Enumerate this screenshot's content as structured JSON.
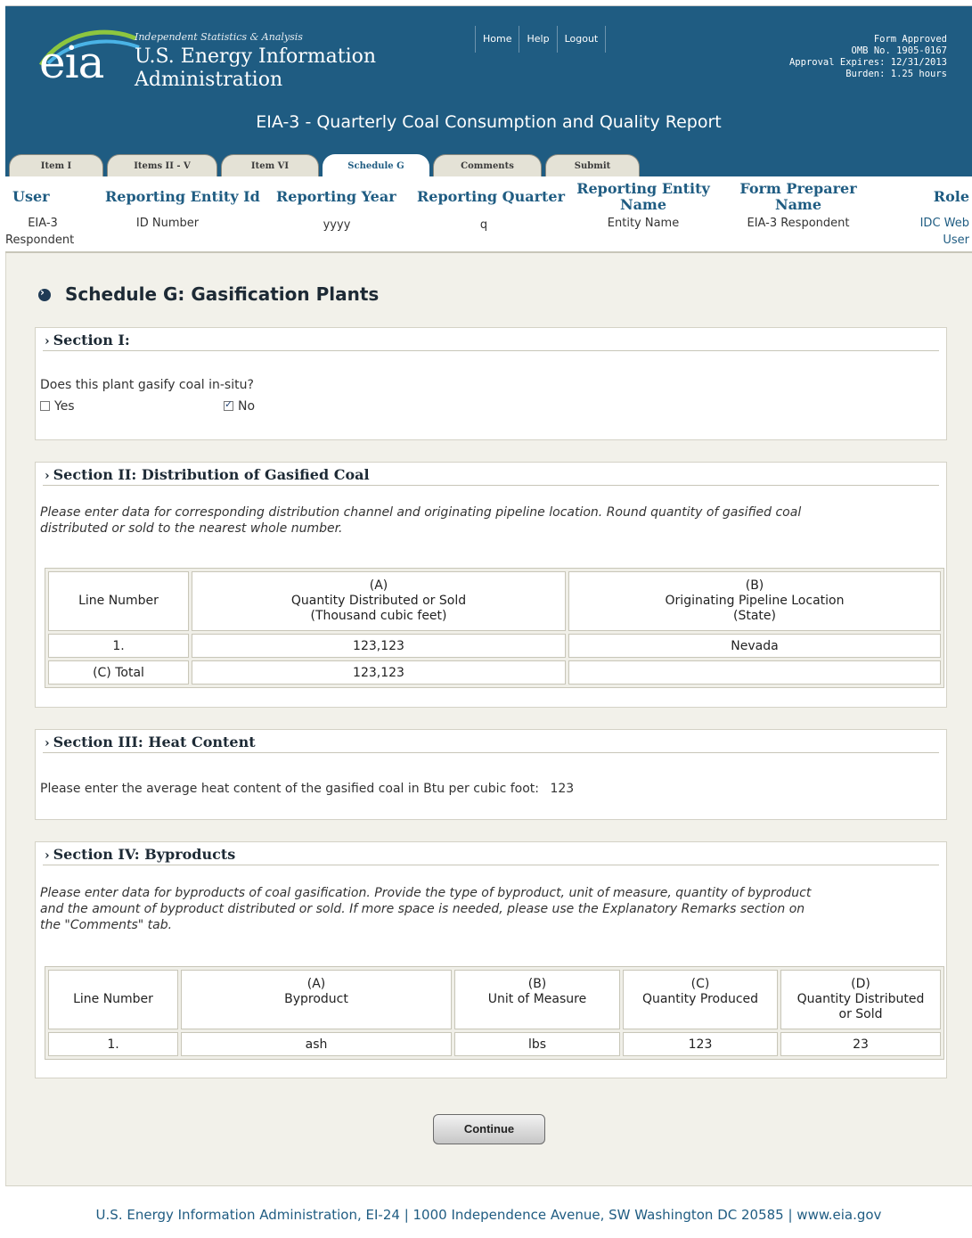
{
  "header": {
    "logo_text": "eia",
    "tagline": "Independent Statistics & Analysis",
    "org_line1": "U.S. Energy Information",
    "org_line2": "Administration",
    "nav": [
      "Home",
      "Help",
      "Logout"
    ],
    "approval": [
      "Form Approved",
      "OMB No. 1905-0167",
      "Approval Expires: 12/31/2013",
      "Burden: 1.25 hours"
    ],
    "form_title": "EIA-3 - Quarterly Coal Consumption and Quality Report",
    "colors": {
      "banner": "#1f5c82",
      "logo_swoosh_green": "#8dc63f",
      "logo_swoosh_blue": "#4ab3e6"
    }
  },
  "tabs": [
    {
      "label": "Item I",
      "active": false
    },
    {
      "label": "Items II - V",
      "active": false
    },
    {
      "label": "Item VI",
      "active": false
    },
    {
      "label": "Schedule G",
      "active": true
    },
    {
      "label": "Comments",
      "active": false
    },
    {
      "label": "Submit",
      "active": false
    }
  ],
  "info": {
    "headers": [
      "User",
      "Reporting Entity Id",
      "Reporting Year",
      "Reporting Quarter",
      "Reporting Entity Name",
      "Form Preparer Name",
      "Role"
    ],
    "user_1": "EIA-3",
    "user_2": "Respondent",
    "entity_id": "ID Number",
    "year": "yyyy",
    "quarter": "q",
    "entity_name": "Entity Name",
    "preparer": "EIA-3 Respondent",
    "role_1": "IDC Web",
    "role_2": "User"
  },
  "page": {
    "heading_icon": "circle-chevron-right-icon",
    "heading": "Schedule G: Gasification Plants"
  },
  "section1": {
    "title": "Section I:",
    "question": "Does this plant gasify coal in-situ?",
    "yes_label": "Yes",
    "no_label": "No",
    "yes_checked": false,
    "no_checked": true
  },
  "section2": {
    "title": "Section II: Distribution of Gasified Coal",
    "instr_1": "Please enter data for corresponding distribution channel and originating pipeline location. Round quantity of gasified coal",
    "instr_2": "distributed or sold to the nearest whole number.",
    "col_line": "Line Number",
    "col_a": [
      "(A)",
      "Quantity Distributed or Sold",
      "(Thousand cubic feet)"
    ],
    "col_b": [
      "(B)",
      "Originating Pipeline Location",
      "(State)"
    ],
    "rows": [
      {
        "line": "1.",
        "qty": "123,123",
        "state": "Nevada"
      }
    ],
    "total_label": "(C) Total",
    "total_value": "123,123"
  },
  "section3": {
    "title": "Section III: Heat Content",
    "text": "Please enter the average heat content of the gasified coal in Btu per cubic foot:",
    "value": "123"
  },
  "section4": {
    "title": "Section IV: Byproducts",
    "instr_1": "Please enter data for byproducts of coal gasification. Provide the type of byproduct, unit of measure, quantity of byproduct",
    "instr_2": "and the amount of byproduct distributed or sold. If more space is needed, please use the Explanatory Remarks section on",
    "instr_3": "the \"Comments\" tab.",
    "col_line": "Line Number",
    "col_a": [
      "(A)",
      "Byproduct"
    ],
    "col_b": [
      "(B)",
      "Unit of Measure"
    ],
    "col_c": [
      "(C)",
      "Quantity Produced"
    ],
    "col_d": [
      "(D)",
      "Quantity Distributed",
      "or Sold"
    ],
    "rows": [
      {
        "line": "1.",
        "byproduct": "ash",
        "unit": "lbs",
        "produced": "123",
        "distributed": "23"
      }
    ]
  },
  "continue_label": "Continue",
  "footer": "U.S. Energy Information Administration, EI-24 | 1000 Independence Avenue, SW Washington DC 20585  | www.eia.gov"
}
